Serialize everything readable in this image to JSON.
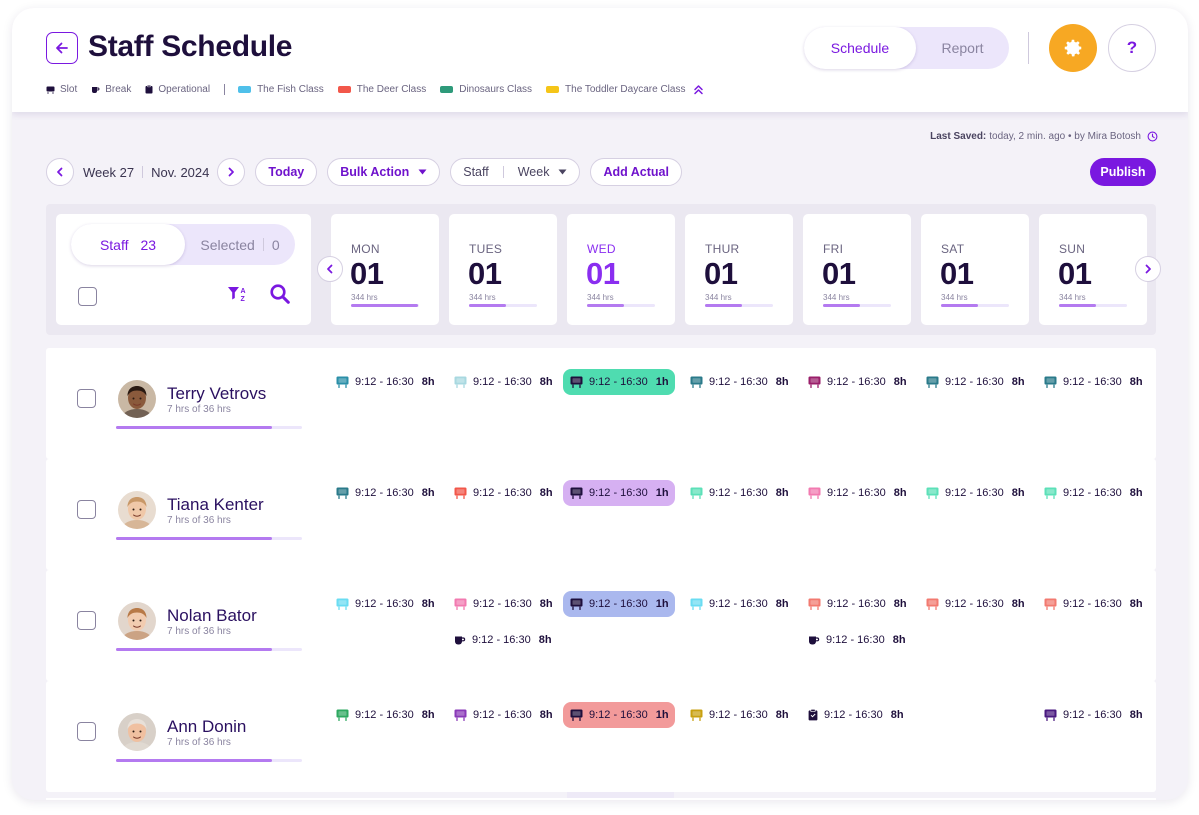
{
  "header": {
    "title": "Staff Schedule",
    "tabs": [
      {
        "label": "Schedule",
        "active": true
      },
      {
        "label": "Report",
        "active": false
      }
    ],
    "help_label": "?",
    "legend": {
      "types": [
        {
          "label": "Slot",
          "icon": "slot-icon"
        },
        {
          "label": "Break",
          "icon": "cup-icon"
        },
        {
          "label": "Operational",
          "icon": "clipboard-icon"
        }
      ],
      "classes": [
        {
          "label": "The Fish Class",
          "color": "#4fc0ea"
        },
        {
          "label": "The Deer Class",
          "color": "#f2574a"
        },
        {
          "label": "Dinosaurs Class",
          "color": "#2e9a7a"
        },
        {
          "label": "The Toddler Daycare Class",
          "color": "#f5c518"
        }
      ]
    }
  },
  "last_saved": {
    "label": "Last Saved:",
    "value": "today, 2 min. ago • by Mira Botosh"
  },
  "toolbar": {
    "week": "Week 27",
    "month": "Nov. 2024",
    "today": "Today",
    "bulk_action": "Bulk Action",
    "staff": "Staff",
    "period": "Week",
    "add_actual": "Add Actual",
    "publish": "Publish"
  },
  "staff_panel": {
    "staff_label": "Staff",
    "staff_count": "23",
    "selected_label": "Selected",
    "selected_count": "0"
  },
  "days": [
    {
      "name": "MON",
      "num": "01",
      "hrs": "344 hrs",
      "progress": 0.98
    },
    {
      "name": "TUES",
      "num": "01",
      "hrs": "344 hrs",
      "progress": 0.55
    },
    {
      "name": "WED",
      "num": "01",
      "hrs": "344 hrs",
      "progress": 0.55,
      "current": true
    },
    {
      "name": "THUR",
      "num": "01",
      "hrs": "344 hrs",
      "progress": 0.55
    },
    {
      "name": "FRI",
      "num": "01",
      "hrs": "344 hrs",
      "progress": 0.55
    },
    {
      "name": "SAT",
      "num": "01",
      "hrs": "344 hrs",
      "progress": 0.55
    },
    {
      "name": "SUN",
      "num": "01",
      "hrs": "344 hrs",
      "progress": 0.55
    }
  ],
  "staff": [
    {
      "name": "Terry Vetrovs",
      "hours": "7 hrs of 36 hrs",
      "progress": 0.84,
      "avatar": {
        "skin": "#8a5a3c",
        "hair": "#2a1a12",
        "bg": "#c9b8a4"
      },
      "shifts": [
        [
          {
            "type": "slot",
            "color": "#2a8fa8",
            "time": "9:12 - 16:30",
            "dur": "8h"
          }
        ],
        [
          {
            "type": "slot",
            "color": "#a8d8e0",
            "time": "9:12 - 16:30",
            "dur": "8h"
          }
        ],
        [
          {
            "type": "slot",
            "color": "#1e0f3c",
            "time": "9:12 - 16:30",
            "dur": "1h",
            "highlight": "#4fdcb0"
          }
        ],
        [
          {
            "type": "slot",
            "color": "#2a7a8a",
            "time": "9:12 - 16:30",
            "dur": "8h"
          }
        ],
        [
          {
            "type": "slot",
            "color": "#9a1e6a",
            "time": "9:12 - 16:30",
            "dur": "8h"
          }
        ],
        [
          {
            "type": "slot",
            "color": "#2a7a8a",
            "time": "9:12 - 16:30",
            "dur": "8h"
          }
        ],
        [
          {
            "type": "slot",
            "color": "#2a7a8a",
            "time": "9:12 - 16:30",
            "dur": "8h"
          }
        ]
      ]
    },
    {
      "name": "Tiana Kenter",
      "hours": "7 hrs of 36 hrs",
      "progress": 0.84,
      "avatar": {
        "skin": "#f0c8a8",
        "hair": "#c89868",
        "bg": "#e8dcd0"
      },
      "shifts": [
        [
          {
            "type": "slot",
            "color": "#2a7a8a",
            "time": "9:12 - 16:30",
            "dur": "8h"
          }
        ],
        [
          {
            "type": "slot",
            "color": "#f2574a",
            "time": "9:12 - 16:30",
            "dur": "8h"
          }
        ],
        [
          {
            "type": "slot",
            "color": "#1e0f3c",
            "time": "9:12 - 16:30",
            "dur": "1h",
            "highlight": "#d6b0f2"
          }
        ],
        [
          {
            "type": "slot",
            "color": "#5ce0b8",
            "time": "9:12 - 16:30",
            "dur": "8h"
          }
        ],
        [
          {
            "type": "slot",
            "color": "#f27ab0",
            "time": "9:12 - 16:30",
            "dur": "8h"
          }
        ],
        [
          {
            "type": "slot",
            "color": "#5ce0b8",
            "time": "9:12 - 16:30",
            "dur": "8h"
          }
        ],
        [
          {
            "type": "slot",
            "color": "#5ce0b8",
            "time": "9:12 - 16:30",
            "dur": "8h"
          }
        ]
      ]
    },
    {
      "name": "Nolan Bator",
      "hours": "7 hrs of 36 hrs",
      "progress": 0.84,
      "avatar": {
        "skin": "#f2ccb0",
        "hair": "#b87a48",
        "bg": "#e2d6cc"
      },
      "shifts": [
        [
          {
            "type": "slot",
            "color": "#6adcf2",
            "time": "9:12 - 16:30",
            "dur": "8h"
          }
        ],
        [
          {
            "type": "slot",
            "color": "#f27ab0",
            "time": "9:12 - 16:30",
            "dur": "8h"
          },
          {
            "type": "break",
            "color": "#1e0f3c",
            "time": "9:12 - 16:30",
            "dur": "8h"
          }
        ],
        [
          {
            "type": "slot",
            "color": "#1e0f3c",
            "time": "9:12 - 16:30",
            "dur": "1h",
            "highlight": "#aab8ee"
          }
        ],
        [
          {
            "type": "slot",
            "color": "#6adcf2",
            "time": "9:12 - 16:30",
            "dur": "8h"
          }
        ],
        [
          {
            "type": "slot",
            "color": "#f27a70",
            "time": "9:12 - 16:30",
            "dur": "8h"
          },
          {
            "type": "break",
            "color": "#1e0f3c",
            "time": "9:12 - 16:30",
            "dur": "8h"
          }
        ],
        [
          {
            "type": "slot",
            "color": "#f27a70",
            "time": "9:12 - 16:30",
            "dur": "8h"
          }
        ],
        [
          {
            "type": "slot",
            "color": "#f27a70",
            "time": "9:12 - 16:30",
            "dur": "8h"
          }
        ]
      ]
    },
    {
      "name": "Ann Donin",
      "hours": "7 hrs of 36 hrs",
      "progress": 0.84,
      "avatar": {
        "skin": "#f0c0a0",
        "hair": "#e8e0d8",
        "bg": "#d8d0c8"
      },
      "shifts": [
        [
          {
            "type": "slot",
            "color": "#2ea860",
            "time": "9:12 - 16:30",
            "dur": "8h"
          }
        ],
        [
          {
            "type": "slot",
            "color": "#8a3ab8",
            "time": "9:12 - 16:30",
            "dur": "8h"
          }
        ],
        [
          {
            "type": "slot",
            "color": "#1e0f3c",
            "time": "9:12 - 16:30",
            "dur": "1h",
            "highlight": "#f29a9a"
          }
        ],
        [
          {
            "type": "slot",
            "color": "#c8a010",
            "time": "9:12 - 16:30",
            "dur": "8h"
          }
        ],
        [
          {
            "type": "operational",
            "color": "#1e0f3c",
            "time": "9:12 - 16:30",
            "dur": "8h"
          }
        ],
        [],
        [
          {
            "type": "slot",
            "color": "#4a1a80",
            "time": "9:12 - 16:30",
            "dur": "8h"
          }
        ]
      ]
    }
  ]
}
